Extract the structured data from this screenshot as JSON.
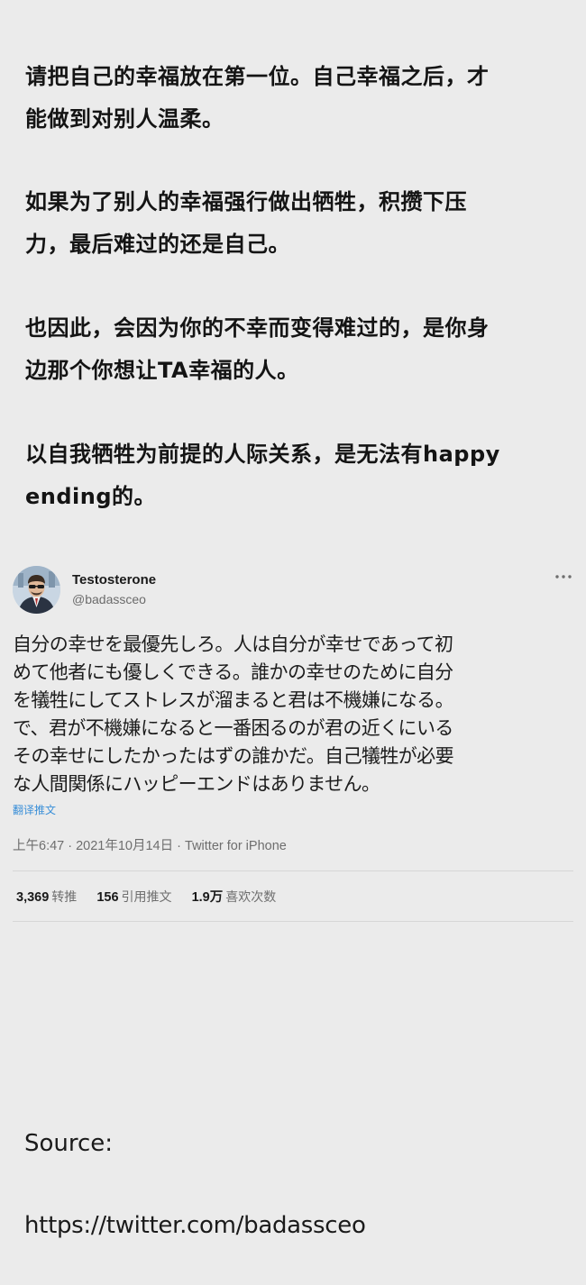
{
  "quote": {
    "p1": [
      "请把自己的幸福放在第一位。自己幸福之后，才",
      "能做到对别人温柔。"
    ],
    "p2": [
      "如果为了别人的幸福强行做出牺牲，积攒下压",
      "力，最后难过的还是自己。"
    ],
    "p3": [
      "也因此，会因为你的不幸而变得难过的，是你身",
      "边那个你想让TA幸福的人。"
    ],
    "p4": [
      "以自我牺牲为前提的人际关系，是无法有happy",
      "ending的。"
    ]
  },
  "tweet": {
    "author_name": "Testosterone",
    "author_handle": "@badassceo",
    "avatar_icon": "profile-avatar-man-in-suit-sunglasses",
    "more_icon": "more-dots-icon",
    "text_lines": [
      "自分の幸せを最優先しろ。人は自分が幸せであって初",
      "めて他者にも優しくできる。誰かの幸せのために自分",
      "を犠牲にしてストレスが溜まると君は不機嫌になる。",
      "で、君が不機嫌になると一番困るのが君の近くにいる",
      "その幸せにしたかったはずの誰かだ。自己犠牲が必要",
      "な人間関係にハッピーエンドはありません。"
    ],
    "translate_label": "翻译推文",
    "meta": "上午6:47 · 2021年10月14日 · Twitter for iPhone",
    "stats": {
      "retweets_num": "3,369",
      "retweets_label": "转推",
      "quotes_num": "156",
      "quotes_label": "引用推文",
      "likes_num": "1.9万",
      "likes_label": "喜欢次数"
    }
  },
  "source": {
    "label": "Source:",
    "url": "https://twitter.com/badassceo"
  },
  "colors": {
    "background": "#ebebeb",
    "link": "#3a8fd8",
    "muted": "#6e6e6e"
  }
}
